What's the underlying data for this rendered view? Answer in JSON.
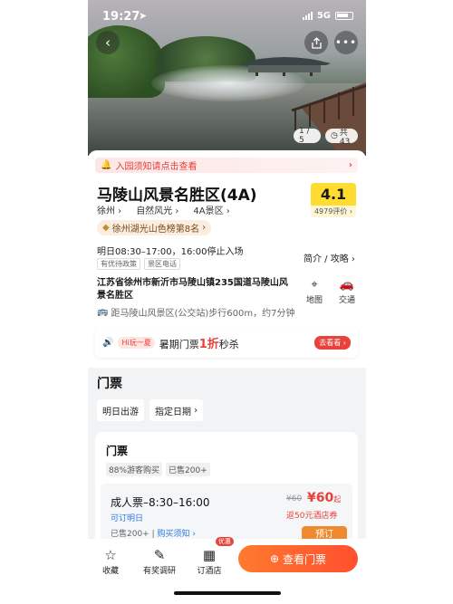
{
  "status": {
    "time": "19:27",
    "network": "5G"
  },
  "gallery": {
    "counter": "1 / 5",
    "total": "共 43"
  },
  "notice": {
    "text": "入园须知请点击查看"
  },
  "attraction": {
    "title": "马陵山风景名胜区(4A)",
    "categories": [
      "徐州",
      "自然风光",
      "4A景区"
    ],
    "rank": "徐州湖光山色榜第8名",
    "score": "4.1",
    "reviews": "4979评价",
    "hours": "明日08:30–17:00，16:00停止入场",
    "tags": [
      "有优待政策",
      "景区电话"
    ],
    "guide_label": "简介 / 攻略",
    "address": "江苏省徐州市新沂市马陵山镇235国道马陵山风景名胜区",
    "distance": "距马陵山风景区(公交站)步行600m，约7分钟",
    "map_label": "地图",
    "transport_label": "交通"
  },
  "promo": {
    "badge": "Hi玩一夏",
    "text_before": "暑期门票",
    "highlight": "1折",
    "text_after": "秒杀",
    "button": "去看看"
  },
  "tickets": {
    "section_title": "门票",
    "date_options": [
      "明日出游",
      "指定日期"
    ],
    "card_title": "门票",
    "sales_tags": [
      "88%游客购买",
      "已售200+"
    ],
    "item": {
      "name": "成人票–8:30–16:00",
      "availability": "可订明日",
      "sold": "已售200+",
      "notice_link": "购买须知",
      "original_price": "¥60",
      "price": "¥60",
      "price_suffix": "起",
      "coupon": "返50元酒店券",
      "book_label": "预订"
    }
  },
  "bottom_bar": {
    "tabs": [
      "收藏",
      "有奖调研",
      "订酒店"
    ],
    "hot_badge": "优惠",
    "cta": "查看门票"
  },
  "colors": {
    "accent": "#e8403a",
    "score_bg": "#ffdc2f",
    "cta": "#ff5a2f"
  }
}
